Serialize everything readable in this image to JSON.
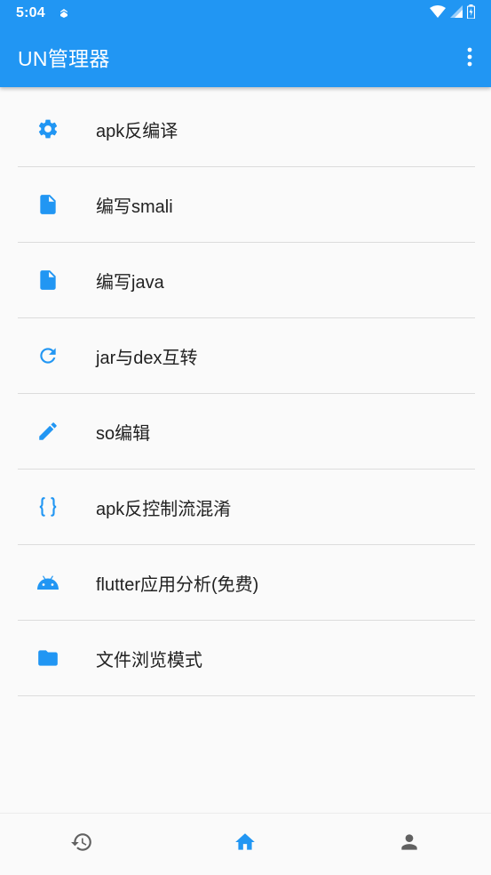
{
  "status_bar": {
    "time": "5:04"
  },
  "app_bar": {
    "title": "UN管理器"
  },
  "menu_items": [
    {
      "label": "apk反编译",
      "icon": "gear-icon"
    },
    {
      "label": "编写smali",
      "icon": "file-icon"
    },
    {
      "label": "编写java",
      "icon": "file-icon"
    },
    {
      "label": "jar与dex互转",
      "icon": "refresh-icon"
    },
    {
      "label": "so编辑",
      "icon": "pencil-icon"
    },
    {
      "label": "apk反控制流混淆",
      "icon": "code-braces-icon"
    },
    {
      "label": "flutter应用分析(免费)",
      "icon": "android-icon"
    },
    {
      "label": "文件浏览模式",
      "icon": "folder-icon"
    }
  ],
  "bottom_nav": [
    {
      "name": "history",
      "icon": "history-icon",
      "active": false
    },
    {
      "name": "home",
      "icon": "home-icon",
      "active": true
    },
    {
      "name": "profile",
      "icon": "person-icon",
      "active": false
    }
  ],
  "colors": {
    "primary": "#2196f3",
    "inactive_icon": "#616161"
  }
}
